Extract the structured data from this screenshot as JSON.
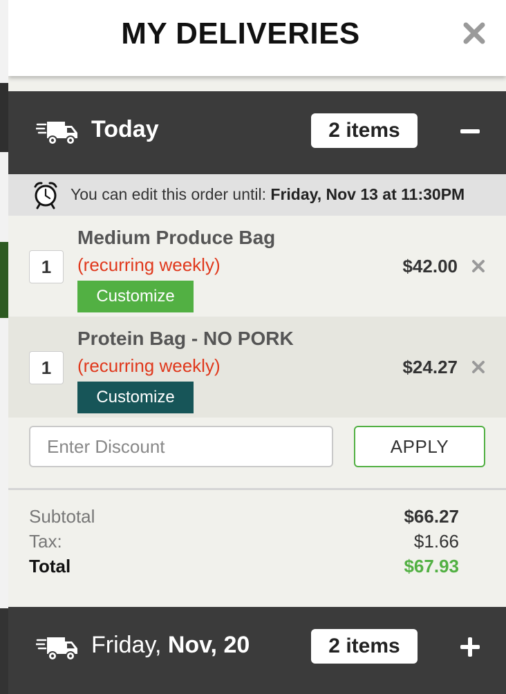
{
  "colors": {
    "accent_green": "#52b043",
    "dark_teal": "#175558",
    "bar_dark": "#3b3b3b",
    "recurring_red": "#e0381c"
  },
  "header": {
    "title": "MY DELIVERIES",
    "close_icon": "close-x-icon"
  },
  "today": {
    "label": "Today",
    "item_count": "2 items",
    "toggle_icon": "minus-icon",
    "edit_note_prefix": "You can edit this order until: ",
    "edit_note_deadline": "Friday, Nov 13 at 11:30PM",
    "items": [
      {
        "qty": "1",
        "name": "Medium Produce Bag",
        "recurrence": "(recurring weekly)",
        "customize_label": "Customize",
        "price": "$42.00"
      },
      {
        "qty": "1",
        "name": "Protein Bag - NO PORK",
        "recurrence": "(recurring weekly)",
        "customize_label": "Customize",
        "price": "$24.27"
      }
    ],
    "discount": {
      "placeholder": "Enter Discount",
      "value": "",
      "apply_label": "APPLY"
    },
    "totals": {
      "subtotal_label": "Subtotal",
      "subtotal": "$66.27",
      "tax_label": "Tax:",
      "tax": "$1.66",
      "total_label": "Total",
      "total": "$67.93"
    }
  },
  "next_delivery": {
    "label_prefix": "Friday, ",
    "label_date": "Nov, 20",
    "item_count": "2 items",
    "toggle_icon": "plus-icon"
  }
}
